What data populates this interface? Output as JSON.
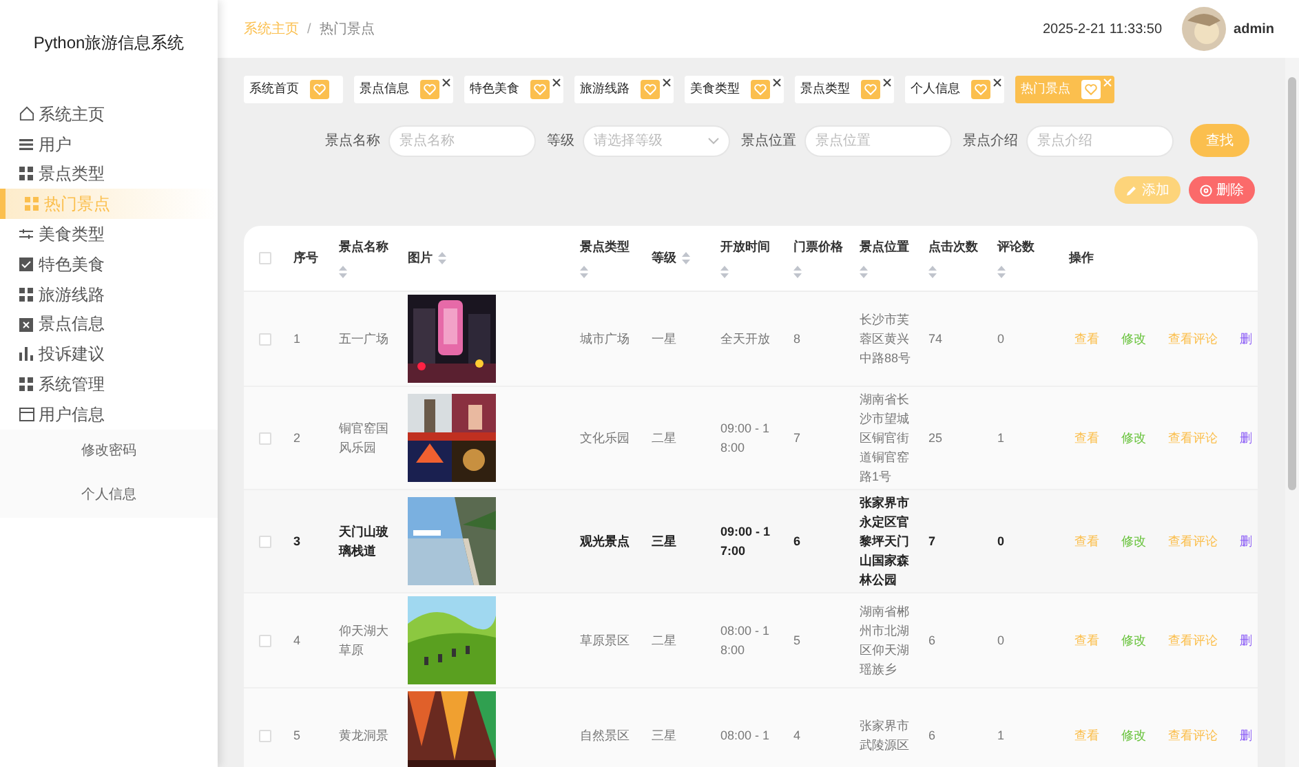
{
  "sidebar": {
    "title": "Python旅游信息系统",
    "items": [
      {
        "label": "系统主页",
        "selected": false
      },
      {
        "label": "用户",
        "selected": false
      },
      {
        "label": "景点类型",
        "selected": false
      },
      {
        "label": "热门景点",
        "selected": true
      },
      {
        "label": "美食类型",
        "selected": false
      },
      {
        "label": "特色美食",
        "selected": false
      },
      {
        "label": "旅游线路",
        "selected": false
      },
      {
        "label": "景点信息",
        "selected": false
      },
      {
        "label": "投诉建议",
        "selected": false
      },
      {
        "label": "系统管理",
        "selected": false
      },
      {
        "label": "用户信息",
        "selected": false,
        "expanded": true,
        "children": [
          {
            "label": "修改密码"
          },
          {
            "label": "个人信息"
          }
        ]
      }
    ]
  },
  "header": {
    "breadcrumb": [
      "系统主页",
      "热门景点"
    ],
    "separator": "/",
    "datetime": "2025-2-21 11:33:50",
    "username": "admin"
  },
  "tabs": [
    {
      "label": "系统首页",
      "selected": false,
      "closable": false
    },
    {
      "label": "景点信息",
      "selected": false,
      "closable": true
    },
    {
      "label": "特色美食",
      "selected": false,
      "closable": true
    },
    {
      "label": "旅游线路",
      "selected": false,
      "closable": true
    },
    {
      "label": "美食类型",
      "selected": false,
      "closable": true
    },
    {
      "label": "景点类型",
      "selected": false,
      "closable": true
    },
    {
      "label": "个人信息",
      "selected": false,
      "closable": true
    },
    {
      "label": "热门景点",
      "selected": true,
      "closable": true
    }
  ],
  "search": {
    "fields": [
      {
        "kind": "input",
        "label": "景点名称",
        "placeholder": "景点名称"
      },
      {
        "kind": "select",
        "label": "等级",
        "placeholder": "请选择等级"
      },
      {
        "kind": "input",
        "label": "景点位置",
        "placeholder": "景点位置"
      },
      {
        "kind": "input",
        "label": "景点介绍",
        "placeholder": "景点介绍"
      }
    ],
    "button": "查找"
  },
  "actions": {
    "add": "添加",
    "delete": "删除"
  },
  "table": {
    "select_all": {
      "checked": false
    },
    "columns": [
      {
        "label": "序号",
        "sortable": false
      },
      {
        "label": "景点名称",
        "sortable": true
      },
      {
        "label": "图片",
        "sortable": true
      },
      {
        "label": "景点类型",
        "sortable": true
      },
      {
        "label": "等级",
        "sortable": true
      },
      {
        "label": "开放时间",
        "sortable": true
      },
      {
        "label": "门票价格",
        "sortable": true
      },
      {
        "label": "景点位置",
        "sortable": true
      },
      {
        "label": "点击次数",
        "sortable": true
      },
      {
        "label": "评论数",
        "sortable": true
      },
      {
        "label": "操作",
        "sortable": false
      }
    ],
    "rows": [
      {
        "checked": false,
        "hovered": false,
        "cells": [
          "1",
          "五一广场",
          "",
          "城市广场",
          "一星",
          "全天开放",
          "8",
          "长沙市芙蓉区黄兴中路88号",
          "74",
          "0"
        ],
        "actions": [
          {
            "label": "查看",
            "color": "#fbbf4e"
          },
          {
            "label": "修改",
            "color": "#67c23a"
          },
          {
            "label": "查看评论",
            "color": "#fbbf4e"
          },
          {
            "label": "删",
            "color": "#8b5cf6"
          }
        ]
      },
      {
        "checked": false,
        "hovered": false,
        "cells": [
          "2",
          "铜官窑国风乐园",
          "",
          "文化乐园",
          "二星",
          "09:00 - 18:00",
          "7",
          "湖南省长沙市望城区铜官街道铜官窑路1号",
          "25",
          "1"
        ],
        "actions": [
          {
            "label": "查看",
            "color": "#fbbf4e"
          },
          {
            "label": "修改",
            "color": "#67c23a"
          },
          {
            "label": "查看评论",
            "color": "#fbbf4e"
          },
          {
            "label": "删",
            "color": "#8b5cf6"
          }
        ]
      },
      {
        "checked": false,
        "hovered": true,
        "cells": [
          "3",
          "天门山玻璃栈道",
          "",
          "观光景点",
          "三星",
          "09:00 - 17:00",
          "6",
          "张家界市永定区官黎坪天门山国家森林公园",
          "7",
          "0"
        ],
        "actions": [
          {
            "label": "查看",
            "color": "#fbbf4e"
          },
          {
            "label": "修改",
            "color": "#67c23a"
          },
          {
            "label": "查看评论",
            "color": "#fbbf4e"
          },
          {
            "label": "删",
            "color": "#8b5cf6"
          }
        ]
      },
      {
        "checked": false,
        "hovered": false,
        "cells": [
          "4",
          "仰天湖大草原",
          "",
          "草原景区",
          "二星",
          "08:00 - 18:00",
          "5",
          "湖南省郴州市北湖区仰天湖瑶族乡",
          "6",
          "0"
        ],
        "actions": [
          {
            "label": "查看",
            "color": "#fbbf4e"
          },
          {
            "label": "修改",
            "color": "#67c23a"
          },
          {
            "label": "查看评论",
            "color": "#fbbf4e"
          },
          {
            "label": "删",
            "color": "#8b5cf6"
          }
        ]
      },
      {
        "checked": false,
        "hovered": false,
        "cells": [
          "5",
          "黄龙洞景",
          "",
          "自然景区",
          "三星",
          "08:00 - 1",
          "4",
          "张家界市武陵源区",
          "6",
          "1"
        ],
        "actions": [
          {
            "label": "查看",
            "color": "#fbbf4e"
          },
          {
            "label": "修改",
            "color": "#67c23a"
          },
          {
            "label": "查看评论",
            "color": "#fbbf4e"
          },
          {
            "label": "删",
            "color": "#8b5cf6"
          }
        ]
      }
    ]
  }
}
